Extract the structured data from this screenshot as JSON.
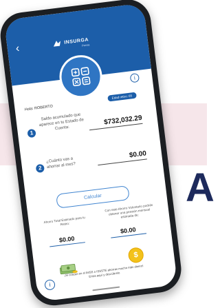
{
  "brand": {
    "name": "INSURGA",
    "sub": "Pensa"
  },
  "greeting": "Hola: ROBERTO",
  "age_badge": "Edad retiro: 65",
  "step1": {
    "number": "1",
    "label": "Saldo acumulado que aparece en tu Estado de Cuenta:",
    "amount": "$732,032.29"
  },
  "step2": {
    "number": "2",
    "label": "¿Cuánto vas a ahorrar al mes?",
    "amount": "$0.00"
  },
  "calc_button": "Calcular",
  "results": {
    "left": {
      "label": "Ahorro Total Estimado para tu Retiro:",
      "value": "$0.00"
    },
    "right": {
      "label": "Con este Ahorro Voluntario podrás obtener una pensión mensual estimada de:",
      "value": "$0.00"
    }
  },
  "footer_text": "¡Si cotizas en el IMSS o ISSSTE ahorras mucho más dinero! Entra aquí y descúbrelo",
  "coin_symbol": "$",
  "bg_glyph": "A",
  "colors": {
    "primary": "#1c5ea9",
    "accent": "#3f84d0",
    "coin": "#f3c21b",
    "band": "#f6e6ea"
  }
}
